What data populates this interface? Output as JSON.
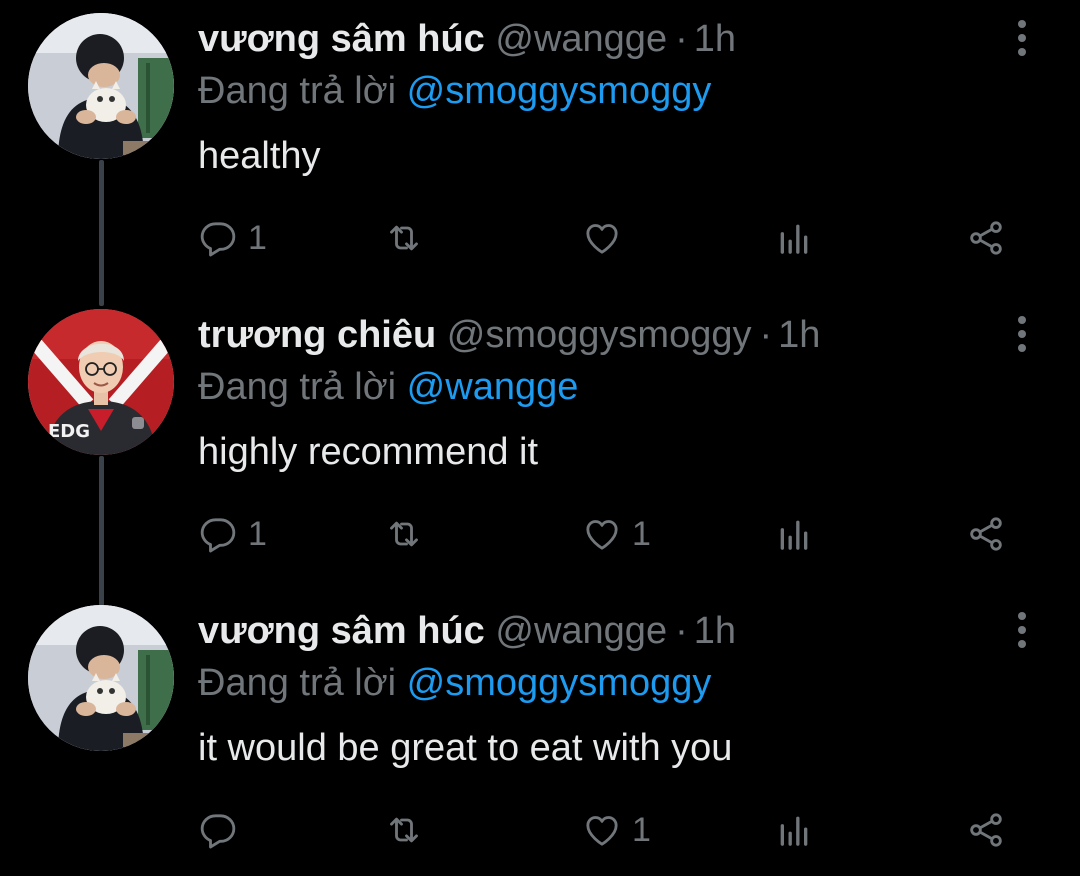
{
  "colors": {
    "background": "#000000",
    "text_primary": "#e7e9ea",
    "text_secondary": "#71767b",
    "accent": "#1d9bf0",
    "thread_line": "#3a4148"
  },
  "tweets": [
    {
      "display_name": "vương sâm húc",
      "handle": "@wangge",
      "dot": "·",
      "time": "1h",
      "replying_prefix": "Đang trả lời",
      "replying_to": "@smoggysmoggy",
      "text": "healthy",
      "avatar": "person-holding-cat-avatar",
      "actions": {
        "reply_icon": "reply-icon",
        "reply_count": "1",
        "retweet_icon": "retweet-icon",
        "retweet_count": "",
        "like_icon": "heart-icon",
        "like_count": "",
        "views_icon": "views-icon",
        "share_icon": "share-icon"
      }
    },
    {
      "display_name": "trương chiêu",
      "handle": "@smoggysmoggy",
      "dot": "·",
      "time": "1h",
      "replying_prefix": "Đang trả lời",
      "replying_to": "@wangge",
      "text": "highly recommend it",
      "avatar": "esports-player-avatar",
      "avatar_jersey_text": "EDG",
      "actions": {
        "reply_icon": "reply-icon",
        "reply_count": "1",
        "retweet_icon": "retweet-icon",
        "retweet_count": "",
        "like_icon": "heart-icon",
        "like_count": "1",
        "views_icon": "views-icon",
        "share_icon": "share-icon"
      }
    },
    {
      "display_name": "vương sâm húc",
      "handle": "@wangge",
      "dot": "·",
      "time": "1h",
      "replying_prefix": "Đang trả lời",
      "replying_to": "@smoggysmoggy",
      "text": "it would be great to eat with you",
      "avatar": "person-holding-cat-avatar",
      "actions": {
        "reply_icon": "reply-icon",
        "reply_count": "",
        "retweet_icon": "retweet-icon",
        "retweet_count": "",
        "like_icon": "heart-icon",
        "like_count": "1",
        "views_icon": "views-icon",
        "share_icon": "share-icon"
      }
    }
  ]
}
